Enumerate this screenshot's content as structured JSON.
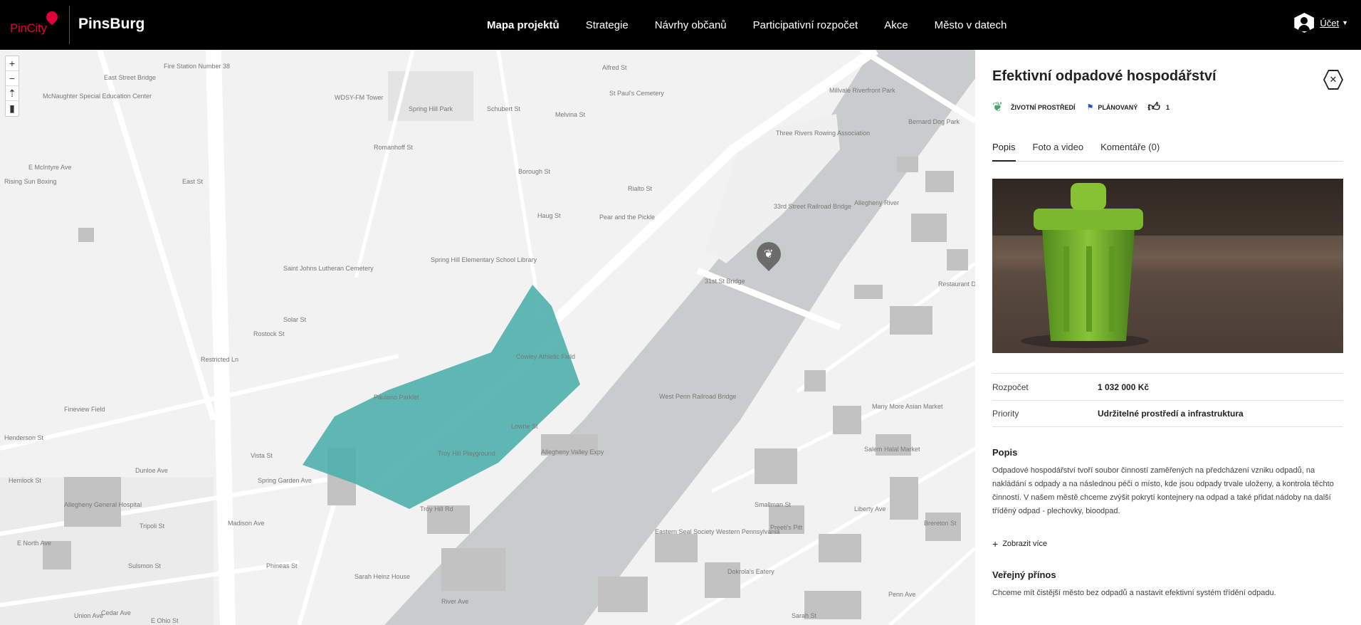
{
  "brand": {
    "logo_text": "PinCity",
    "app_name": "PinsBurg"
  },
  "nav": {
    "items": [
      "Mapa projektů",
      "Strategie",
      "Návrhy občanů",
      "Participativní rozpočet",
      "Akce",
      "Město v datech"
    ]
  },
  "account": {
    "label": "Účet"
  },
  "map": {
    "controls": [
      "+",
      "−",
      "⇡",
      "▮"
    ],
    "labels": [
      "Fire Station Number 38",
      "East Street Bridge",
      "McNaughter Special Education Center",
      "WDSY-FM Tower",
      "Spring Hill Park",
      "Schubert St",
      "Romanhoff St",
      "Borough St",
      "Haug St",
      "Pear and the Pickle",
      "Saint Johns Lutheran Cemetery",
      "Spring Hill Elementary School Library",
      "Solar St",
      "Rostock St",
      "Cowley Athletic Field",
      "Paulano Parklet",
      "Troy Hill Playground",
      "Allegheny Valley Expy",
      "33rd Street Railroad Bridge",
      "31st St Bridge",
      "Three Rivers Rowing Association",
      "Millvale Riverfront Park",
      "West Penn Railroad Bridge",
      "Allegheny River",
      "Many More Asian Market",
      "Salem Halal Market",
      "Eastern Seal Society Western Pennsylvania",
      "Dokrola's Eatery",
      "Preeti's Pitt",
      "Sarah Heinz House",
      "Allegheny General Hospital",
      "Fineview Field",
      "Henderson St",
      "E North Ave",
      "Sulsmon St",
      "E Ohio St",
      "Brereton St",
      "Liberty Ave",
      "Restaurant Depot",
      "Smallman St",
      "Penn Ave",
      "Vista St",
      "Spring Garden Ave",
      "Madison Ave",
      "Restricted Ln",
      "East St",
      "Rising Sun Boxing",
      "E McIntyre Ave",
      "Troy Hill Rd",
      "Hemlock St",
      "Dunloe Ave",
      "Tripoli St",
      "Phineas St",
      "River Ave",
      "St Paul's Cemetery",
      "Melvina St",
      "Alfred St",
      "Bernard Dog Park",
      "Lowrie St",
      "Rialto St",
      "Cedar Ave",
      "Union Ave",
      "Sarah St"
    ]
  },
  "panel": {
    "title": "Efektivní odpadové hospodářství",
    "category": "ŽIVOTNÍ PROSTŘEDÍ",
    "status": "PLÁNOVANÝ",
    "likes": "1",
    "tabs": [
      "Popis",
      "Foto a video",
      "Komentáře (0)"
    ],
    "budget": {
      "label": "Rozpočet",
      "value": "1 032 000 Kč"
    },
    "priority": {
      "label": "Priority",
      "value": "Udržitelné prostředí a infrastruktura"
    },
    "description": {
      "title": "Popis",
      "text": "Odpadové hospodářství tvoří soubor činností zaměřených na předcházení vzniku odpadů, na nakládání s odpady a na následnou péči o místo, kde jsou odpady trvale uloženy, a kontrola těchto činností. V našem městě chceme zvýšit pokrytí kontejnery na odpad a také přidat nádoby na další tříděný odpad - plechovky, bioodpad."
    },
    "show_more": "Zobrazit více",
    "benefit": {
      "title": "Veřejný přínos",
      "text": "Chceme mít čistější město bez odpadů a nastavit efektivní systém třídění odpadu."
    }
  },
  "colors": {
    "accent_polygon": "#4fb0ad",
    "leaf": "#4aa26c",
    "flag": "#1e4fd8"
  }
}
